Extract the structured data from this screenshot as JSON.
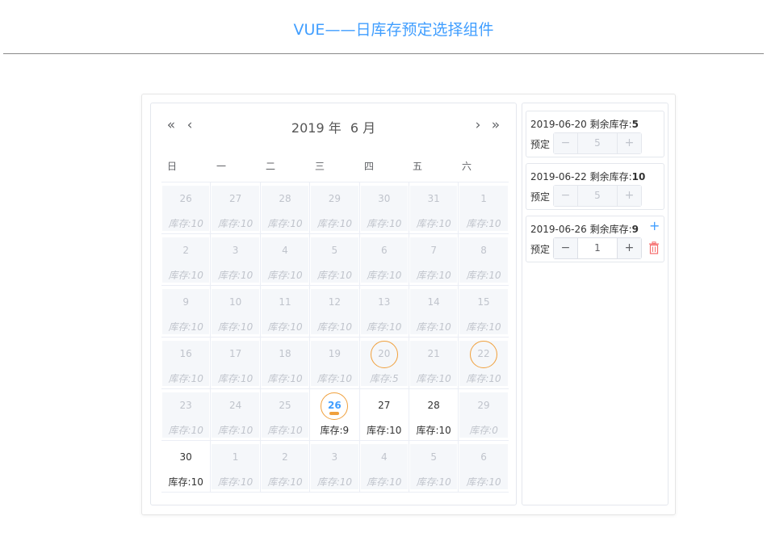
{
  "page": {
    "title": "VUE——日库存预定选择组件"
  },
  "calendar": {
    "nav": {
      "prev_year": "«",
      "prev_month": "‹",
      "next_month": "›",
      "next_year": "»"
    },
    "year_label": "2019 年",
    "month_label": "6 月",
    "weekdays": [
      "日",
      "一",
      "二",
      "三",
      "四",
      "五",
      "六"
    ],
    "stock_prefix": "库存:",
    "weeks": [
      [
        {
          "day": "26",
          "stock": "库存:10",
          "state": "disabled"
        },
        {
          "day": "27",
          "stock": "库存:10",
          "state": "disabled"
        },
        {
          "day": "28",
          "stock": "库存:10",
          "state": "disabled"
        },
        {
          "day": "29",
          "stock": "库存:10",
          "state": "disabled"
        },
        {
          "day": "30",
          "stock": "库存:10",
          "state": "disabled"
        },
        {
          "day": "31",
          "stock": "库存:10",
          "state": "disabled"
        },
        {
          "day": "1",
          "stock": "库存:10",
          "state": "disabled"
        }
      ],
      [
        {
          "day": "2",
          "stock": "库存:10",
          "state": "disabled"
        },
        {
          "day": "3",
          "stock": "库存:10",
          "state": "disabled"
        },
        {
          "day": "4",
          "stock": "库存:10",
          "state": "disabled"
        },
        {
          "day": "5",
          "stock": "库存:10",
          "state": "disabled"
        },
        {
          "day": "6",
          "stock": "库存:10",
          "state": "disabled"
        },
        {
          "day": "7",
          "stock": "库存:10",
          "state": "disabled"
        },
        {
          "day": "8",
          "stock": "库存:10",
          "state": "disabled"
        }
      ],
      [
        {
          "day": "9",
          "stock": "库存:10",
          "state": "disabled"
        },
        {
          "day": "10",
          "stock": "库存:10",
          "state": "disabled"
        },
        {
          "day": "11",
          "stock": "库存:10",
          "state": "disabled"
        },
        {
          "day": "12",
          "stock": "库存:10",
          "state": "disabled"
        },
        {
          "day": "13",
          "stock": "库存:10",
          "state": "disabled"
        },
        {
          "day": "14",
          "stock": "库存:10",
          "state": "disabled"
        },
        {
          "day": "15",
          "stock": "库存:10",
          "state": "disabled"
        }
      ],
      [
        {
          "day": "16",
          "stock": "库存:10",
          "state": "disabled"
        },
        {
          "day": "17",
          "stock": "库存:10",
          "state": "disabled"
        },
        {
          "day": "18",
          "stock": "库存:10",
          "state": "disabled"
        },
        {
          "day": "19",
          "stock": "库存:10",
          "state": "disabled"
        },
        {
          "day": "20",
          "stock": "库存:5",
          "state": "disabled",
          "ring": true
        },
        {
          "day": "21",
          "stock": "库存:10",
          "state": "disabled"
        },
        {
          "day": "22",
          "stock": "库存:10",
          "state": "disabled",
          "ring": true
        }
      ],
      [
        {
          "day": "23",
          "stock": "库存:10",
          "state": "disabled"
        },
        {
          "day": "24",
          "stock": "库存:10",
          "state": "disabled"
        },
        {
          "day": "25",
          "stock": "库存:10",
          "state": "disabled"
        },
        {
          "day": "26",
          "stock": "库存:9",
          "state": "active",
          "ring": true,
          "today": true
        },
        {
          "day": "27",
          "stock": "库存:10",
          "state": "active"
        },
        {
          "day": "28",
          "stock": "库存:10",
          "state": "active"
        },
        {
          "day": "29",
          "stock": "库存:0",
          "state": "disabled"
        }
      ],
      [
        {
          "day": "30",
          "stock": "库存:10",
          "state": "active"
        },
        {
          "day": "1",
          "stock": "库存:10",
          "state": "disabled"
        },
        {
          "day": "2",
          "stock": "库存:10",
          "state": "disabled"
        },
        {
          "day": "3",
          "stock": "库存:10",
          "state": "disabled"
        },
        {
          "day": "4",
          "stock": "库存:10",
          "state": "disabled"
        },
        {
          "day": "5",
          "stock": "库存:10",
          "state": "disabled"
        },
        {
          "day": "6",
          "stock": "库存:10",
          "state": "disabled"
        }
      ]
    ]
  },
  "reservations": {
    "remaining_label": "剩余库存:",
    "book_label": "预定",
    "items": [
      {
        "date": "2019-06-20",
        "remaining": "5",
        "value": "5",
        "disabled": true,
        "minus": "−",
        "plus": "+"
      },
      {
        "date": "2019-06-22",
        "remaining": "10",
        "value": "5",
        "disabled": true,
        "minus": "−",
        "plus": "+"
      },
      {
        "date": "2019-06-26",
        "remaining": "9",
        "value": "1",
        "disabled": false,
        "minus": "−",
        "plus": "+",
        "add_glyph": "+"
      }
    ]
  },
  "colors": {
    "accent": "#409eff",
    "ring": "#f0a03c",
    "delete": "#f56c6c"
  }
}
